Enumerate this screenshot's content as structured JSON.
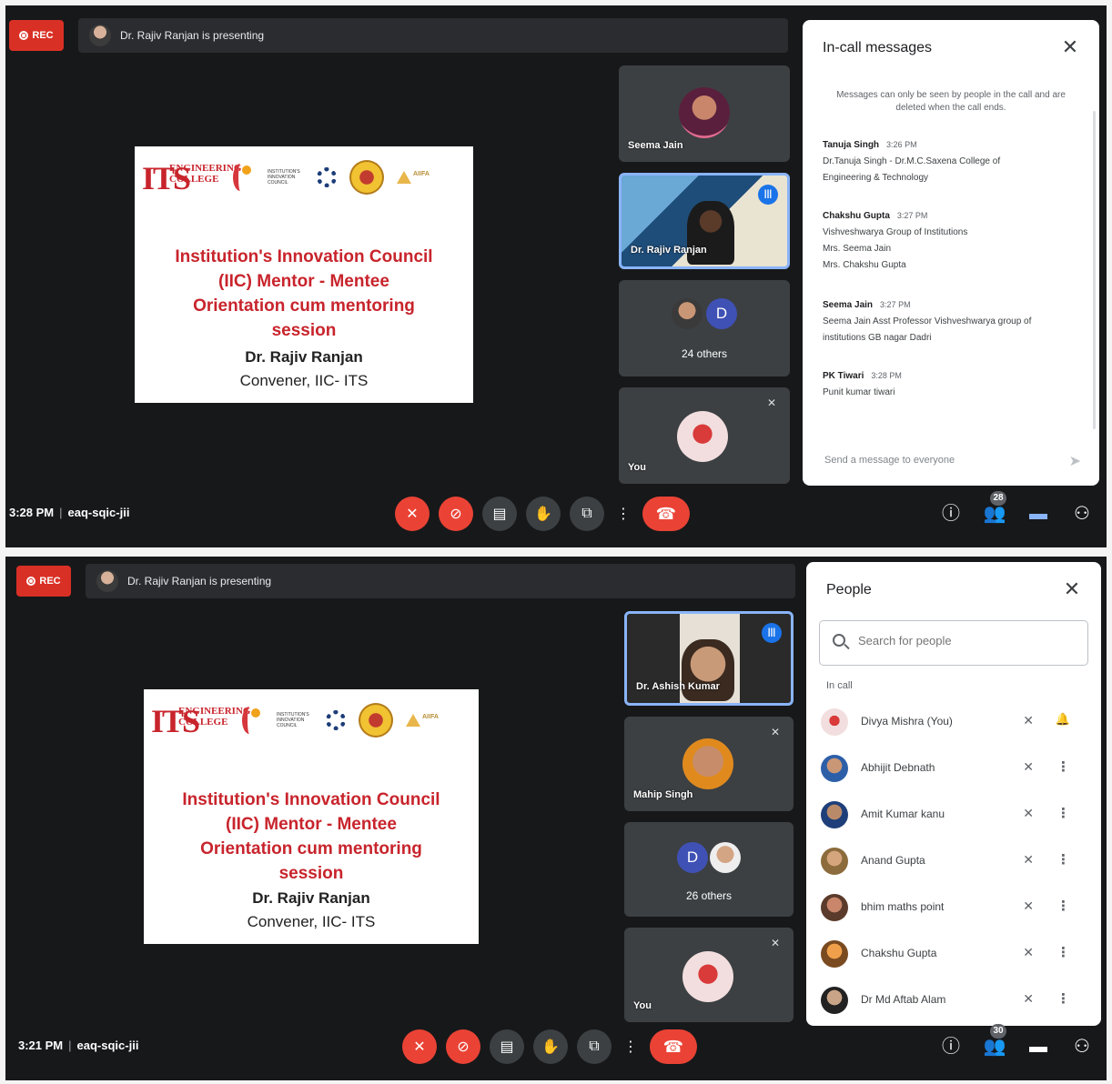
{
  "top_screenshot": {
    "rec_label": "REC",
    "presenting_banner": "Dr. Rajiv Ranjan is presenting",
    "slide": {
      "logo_its_big": "ITS",
      "logo_its_text": "ENGINEERING COLLEGE",
      "logo_iic_text": "INSTITUTION'S INNOVATION COUNCIL",
      "logo_amity": "AIIFA",
      "title_lines": [
        "Institution's Innovation Council",
        "(IIC) Mentor - Mentee",
        "Orientation cum mentoring",
        "session"
      ],
      "presenter": "Dr. Rajiv Ranjan",
      "role": "Convener, IIC- ITS"
    },
    "tiles": [
      {
        "name": "Seema Jain"
      },
      {
        "name": "Dr. Rajiv Ranjan"
      },
      {
        "name": "24 others",
        "initial": "D"
      },
      {
        "name": "You"
      }
    ],
    "meeting": {
      "time": "3:28 PM",
      "code": "eaq-sqic-jii"
    },
    "people_badge": "28",
    "chat_panel": {
      "title": "In-call messages",
      "note": "Messages can only be seen by people in the call and are deleted when the call ends.",
      "messages": [
        {
          "sender": "Tanuja Singh",
          "time": "3:26 PM",
          "lines": [
            "Dr.Tanuja Singh - Dr.M.C.Saxena College of",
            "Engineering & Technology"
          ]
        },
        {
          "sender": "Chakshu Gupta",
          "time": "3:27 PM",
          "lines": [
            "Vishveshwarya Group of Institutions",
            "Mrs. Seema Jain",
            "Mrs. Chakshu Gupta"
          ]
        },
        {
          "sender": "Seema Jain",
          "time": "3:27 PM",
          "lines": [
            "Seema Jain Asst Professor  Vishveshwarya group of",
            "institutions GB nagar Dadri"
          ]
        },
        {
          "sender": "PK Tiwari",
          "time": "3:28 PM",
          "lines": [
            "Punit kumar tiwari"
          ]
        }
      ],
      "send_placeholder": "Send a message to everyone"
    }
  },
  "bottom_screenshot": {
    "rec_label": "REC",
    "presenting_banner": "Dr. Rajiv Ranjan is presenting",
    "slide": {
      "logo_its_big": "ITS",
      "logo_its_text": "ENGINEERING COLLEGE",
      "logo_iic_text": "INSTITUTION'S INNOVATION COUNCIL",
      "logo_amity": "AIIFA",
      "title_lines": [
        "Institution's Innovation Council",
        "(IIC) Mentor - Mentee",
        "Orientation cum mentoring",
        "session"
      ],
      "presenter": "Dr. Rajiv Ranjan",
      "role": "Convener, IIC- ITS"
    },
    "tiles": [
      {
        "name": "Dr. Ashish Kumar"
      },
      {
        "name": "Mahip Singh"
      },
      {
        "name": "26 others",
        "initial": "D"
      },
      {
        "name": "You"
      }
    ],
    "meeting": {
      "time": "3:21 PM",
      "code": "eaq-sqic-jii"
    },
    "people_badge": "30",
    "people_panel": {
      "title": "People",
      "search_placeholder": "Search for people",
      "section_label": "In call",
      "people": [
        {
          "name": "Divya Mishra (You)"
        },
        {
          "name": "Abhijit Debnath"
        },
        {
          "name": "Amit Kumar kanu"
        },
        {
          "name": "Anand Gupta"
        },
        {
          "name": "bhim maths point"
        },
        {
          "name": "Chakshu Gupta"
        },
        {
          "name": "Dr Md Aftab Alam"
        }
      ]
    }
  },
  "icons": {
    "mic_off": "✕",
    "cam_off": "⊘",
    "captions": "▤",
    "hand": "✋",
    "present": "⧉",
    "more": "⋮",
    "end_call": "☎",
    "info": "ⓘ",
    "people": "👥",
    "chat": "▬",
    "activities": "⚇",
    "close": "✕",
    "send": "➤",
    "bell": "🔔"
  },
  "colors": {
    "accent_blue": "#1a73e8",
    "end_red": "#ea4335",
    "slide_red": "#c8242c",
    "meet_bg": "#17181a"
  }
}
